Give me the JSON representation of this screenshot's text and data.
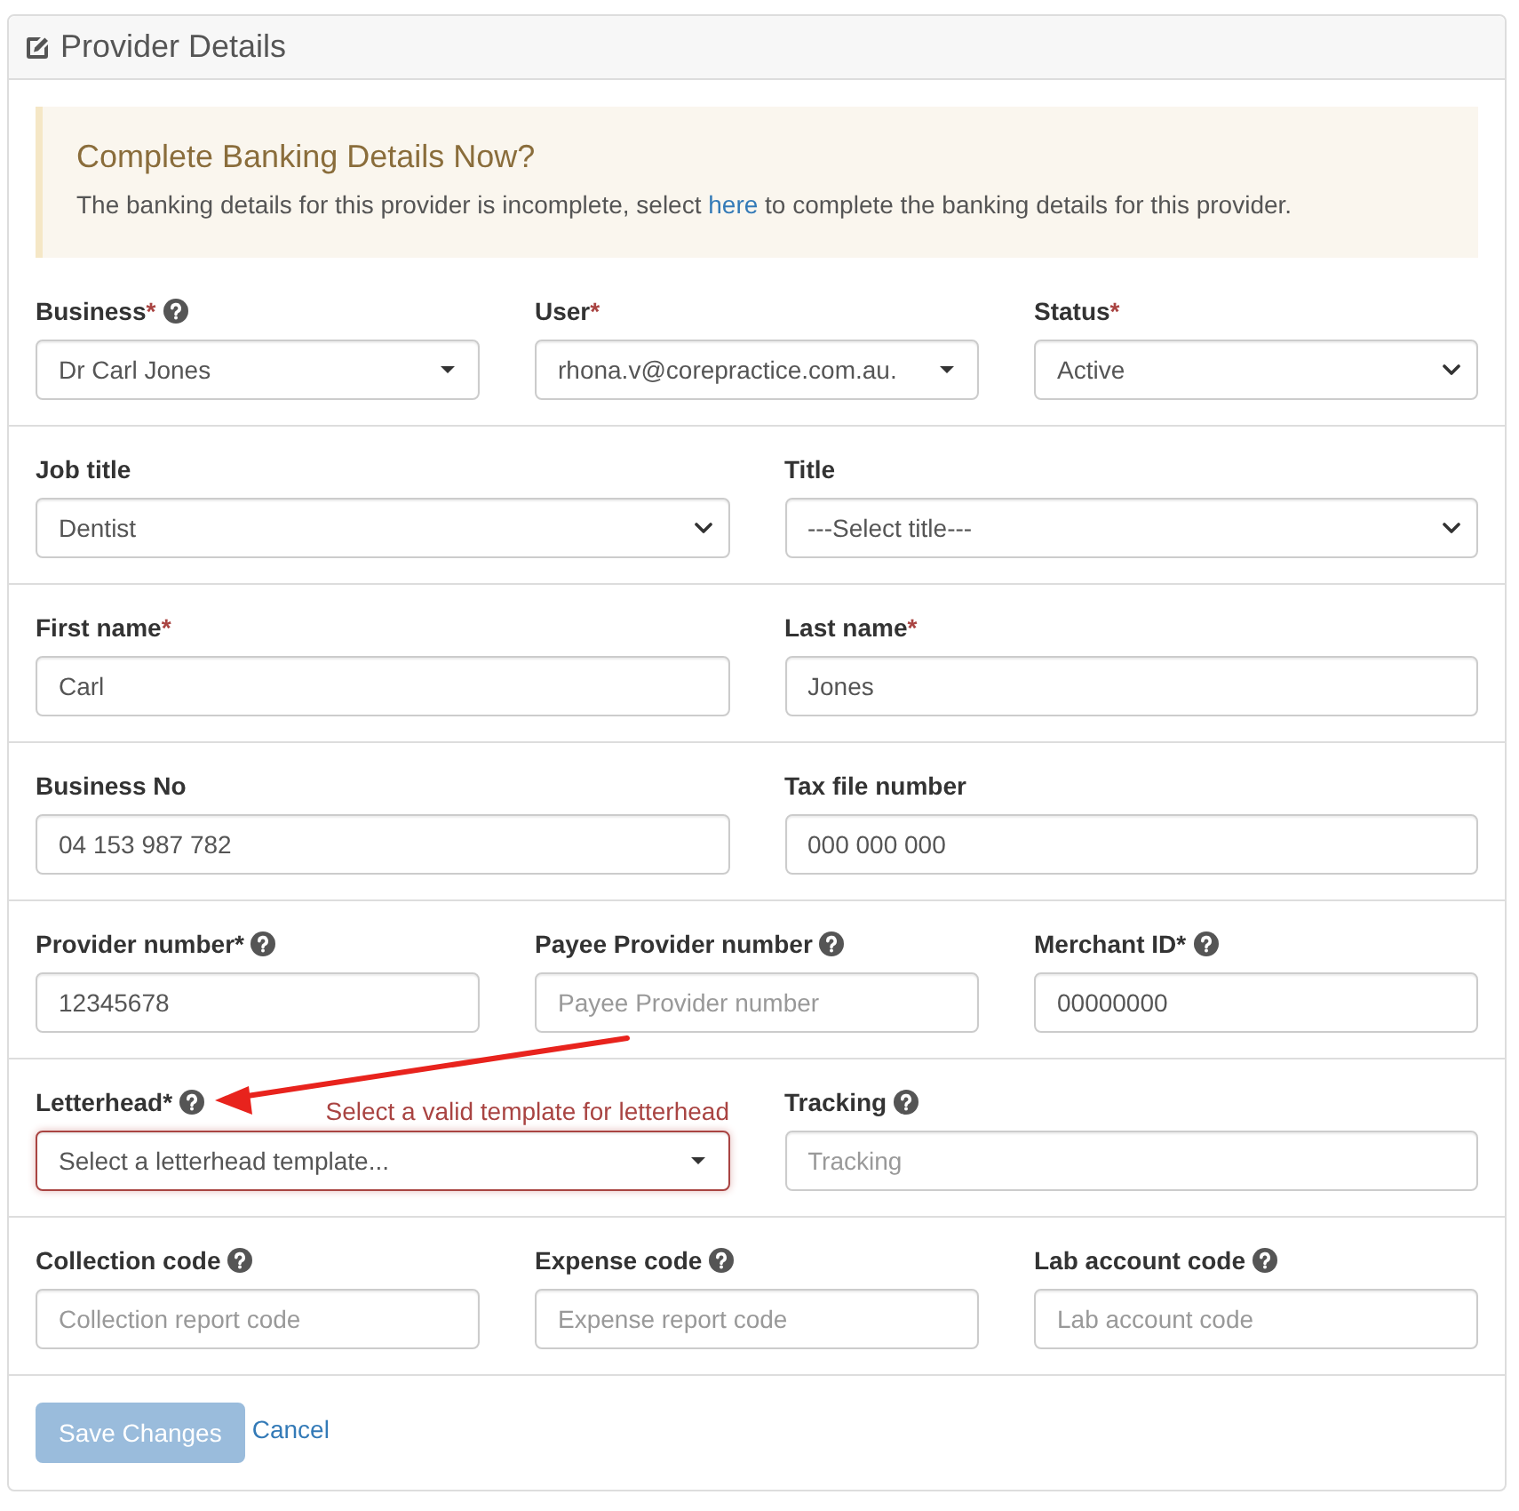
{
  "panel": {
    "title": "Provider Details"
  },
  "alert": {
    "heading": "Complete Banking Details Now?",
    "text_before": "The banking details for this provider is incomplete, select ",
    "link": "here",
    "text_after": " to complete the banking details for this provider."
  },
  "rows": [
    {
      "fields": [
        {
          "label": "Business",
          "mark": "*",
          "mark_red": true,
          "help": true,
          "kind": "combo",
          "value": "Dr Carl Jones",
          "invalid": false
        },
        {
          "label": "User",
          "mark": "*",
          "mark_red": true,
          "help": false,
          "kind": "combo",
          "value": "rhona.v@corepractice.com.au.",
          "invalid": false
        },
        {
          "label": "Status",
          "mark": "*",
          "mark_red": true,
          "help": false,
          "kind": "select",
          "value": "Active",
          "invalid": false
        }
      ]
    },
    {
      "fields": [
        {
          "label": "Job title",
          "help": false,
          "kind": "select",
          "value": "Dentist",
          "invalid": false
        },
        {
          "label": "Title",
          "help": false,
          "kind": "select",
          "value": "---Select title---",
          "invalid": false
        }
      ]
    },
    {
      "fields": [
        {
          "label": "First name",
          "mark": "*",
          "mark_red": true,
          "help": false,
          "kind": "text",
          "value": "Carl",
          "invalid": false
        },
        {
          "label": "Last name",
          "mark": "*",
          "mark_red": true,
          "help": false,
          "kind": "text",
          "value": "Jones",
          "invalid": false
        }
      ]
    },
    {
      "fields": [
        {
          "label": "Business No",
          "help": false,
          "kind": "text",
          "value": "04 153 987 782",
          "invalid": false
        },
        {
          "label": "Tax file number",
          "help": false,
          "kind": "text",
          "value": "000 000 000",
          "invalid": false
        }
      ]
    },
    {
      "fields": [
        {
          "label": "Provider number",
          "mark": "*",
          "mark_red": false,
          "help": true,
          "kind": "text",
          "value": "12345678",
          "invalid": false
        },
        {
          "label": "Payee Provider number",
          "help": true,
          "kind": "text",
          "placeholder": "Payee Provider number",
          "invalid": false
        },
        {
          "label": "Merchant ID",
          "mark": "*",
          "mark_red": false,
          "help": true,
          "kind": "text",
          "value": "00000000",
          "invalid": false
        }
      ]
    },
    {
      "fields": [
        {
          "label": "Letterhead",
          "mark": "*",
          "mark_red": false,
          "help": true,
          "kind": "combo",
          "value": "Select a letterhead template...",
          "invalid": true,
          "error": "Select a valid template for letterhead"
        },
        {
          "label": "Tracking",
          "help": true,
          "kind": "text",
          "placeholder": "Tracking",
          "invalid": false
        }
      ]
    },
    {
      "fields": [
        {
          "label": "Collection code",
          "help": true,
          "kind": "text",
          "placeholder": "Collection report code",
          "invalid": false
        },
        {
          "label": "Expense code",
          "help": true,
          "kind": "text",
          "placeholder": "Expense report code",
          "invalid": false
        },
        {
          "label": "Lab account code",
          "help": true,
          "kind": "text",
          "placeholder": "Lab account code",
          "invalid": false
        }
      ]
    }
  ],
  "actions": {
    "save": {
      "label": "Save Changes",
      "disabled": true
    },
    "cancel": "Cancel"
  }
}
